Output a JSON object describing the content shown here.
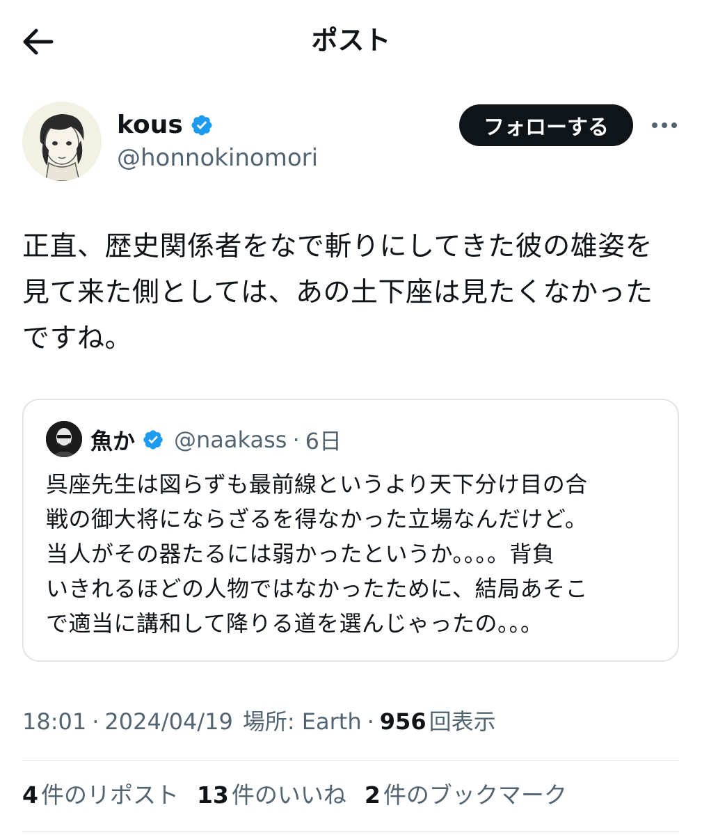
{
  "header": {
    "title": "ポスト"
  },
  "author": {
    "name": "kous",
    "handle": "@honnokinomori",
    "follow_label": "フォローする"
  },
  "post": {
    "lines": [
      "正直、歴史関係者をなで斬りにしてきた彼の雄姿を",
      "見て来た側としては、あの土下座は見たくなかった",
      "ですね。"
    ]
  },
  "quote": {
    "name": "魚か",
    "handle": "@naakass",
    "separator": "·",
    "time": "6日",
    "lines": [
      "呉座先生は図らずも最前線というより天下分け目の合",
      "戦の御大将にならざるを得なかった立場なんだけど。",
      "当人がその器たるには弱かったというか。。。。背負",
      "いきれるほどの人物ではなかったために、結局あそこ",
      "で適当に講和して降りる道を選んじゃったの。。。"
    ]
  },
  "meta": {
    "time": "18:01",
    "dot1": "·",
    "date": "2024/04/19",
    "location": "場所: Earth",
    "dot2": "·",
    "views_count": "956",
    "views_label": "回表示"
  },
  "stats": {
    "reposts_count": "4",
    "reposts_label": "件のリポスト",
    "likes_count": "13",
    "likes_label": "件のいいね",
    "bookmarks_count": "2",
    "bookmarks_label": "件のブックマーク"
  },
  "colors": {
    "text": "#0f1419",
    "secondary": "#536471",
    "verified": "#1d9bf0",
    "border": "#e1e6ea"
  },
  "icons": [
    "back-arrow-icon",
    "verified-badge-icon",
    "more-icon"
  ]
}
